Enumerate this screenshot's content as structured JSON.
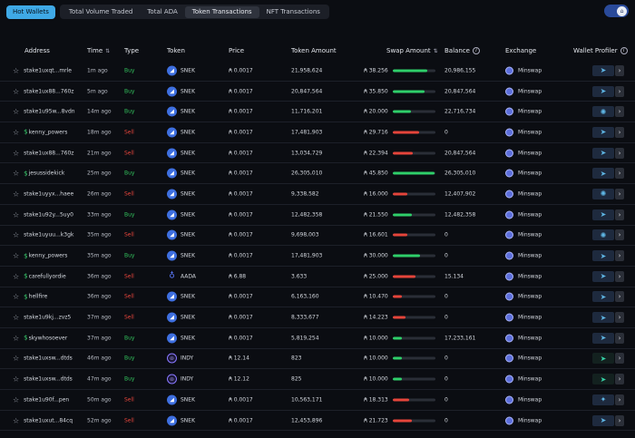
{
  "tabs": {
    "hot": "Hot Wallets",
    "items": [
      "Total Volume Traded",
      "Total ADA",
      "Token Transactions",
      "NFT Transactions"
    ],
    "active_index": 2
  },
  "toggle": {
    "icon": "home-icon",
    "accent": "#2a4a9a"
  },
  "headers": {
    "address": "Address",
    "time": "Time",
    "type": "Type",
    "token": "Token",
    "price": "Price",
    "token_amount": "Token Amount",
    "swap_amount": "Swap Amount",
    "balance": "Balance",
    "exchange": "Exchange",
    "wallet_profiler": "Wallet Profiler"
  },
  "colors": {
    "buy": "#32c25d",
    "sell": "#e5453b",
    "accent": "#3fa9e6"
  },
  "rows": [
    {
      "address": "stake1uxqt...mrle",
      "dollar": false,
      "time": "1m ago",
      "type": "Buy",
      "token": "SNEK",
      "price": "₳ 0.0017",
      "amount": "21,958,624",
      "swap": "₳ 38.256",
      "fill": 0.82,
      "balance": "20,986,155",
      "exchange": "Minswap",
      "whale": "shark"
    },
    {
      "address": "stake1ux88...760z",
      "dollar": false,
      "time": "5m ago",
      "type": "Buy",
      "token": "SNEK",
      "price": "₳ 0.0017",
      "amount": "20,847,564",
      "swap": "₳ 35.850",
      "fill": 0.76,
      "balance": "20,847,564",
      "exchange": "Minswap",
      "whale": "shark"
    },
    {
      "address": "stake1u95w...8vdn",
      "dollar": false,
      "time": "14m ago",
      "type": "Buy",
      "token": "SNEK",
      "price": "₳ 0.0017",
      "amount": "11,716,201",
      "swap": "₳ 20.000",
      "fill": 0.43,
      "balance": "22,716,734",
      "exchange": "Minswap",
      "whale": "octopus"
    },
    {
      "address": "kenny_powers",
      "dollar": true,
      "time": "18m ago",
      "type": "Sell",
      "token": "SNEK",
      "price": "₳ 0.0017",
      "amount": "17,481,903",
      "swap": "₳ 29.716",
      "fill": 0.63,
      "balance": "0",
      "exchange": "Minswap",
      "whale": "shark"
    },
    {
      "address": "stake1ux88...760z",
      "dollar": false,
      "time": "21m ago",
      "type": "Sell",
      "token": "SNEK",
      "price": "₳ 0.0017",
      "amount": "13,034,729",
      "swap": "₳ 22.394",
      "fill": 0.48,
      "balance": "20,847,564",
      "exchange": "Minswap",
      "whale": "shark"
    },
    {
      "address": "jesussidekick",
      "dollar": true,
      "time": "25m ago",
      "type": "Buy",
      "token": "SNEK",
      "price": "₳ 0.0017",
      "amount": "26,305,010",
      "swap": "₳ 45.850",
      "fill": 0.98,
      "balance": "26,305,010",
      "exchange": "Minswap",
      "whale": "shark"
    },
    {
      "address": "stake1uyyx...haee",
      "dollar": false,
      "time": "26m ago",
      "type": "Sell",
      "token": "SNEK",
      "price": "₳ 0.0017",
      "amount": "9,338,582",
      "swap": "₳ 16.000",
      "fill": 0.34,
      "balance": "12,407,902",
      "exchange": "Minswap",
      "whale": "octopus"
    },
    {
      "address": "stake1u92y...5uy0",
      "dollar": false,
      "time": "33m ago",
      "type": "Buy",
      "token": "SNEK",
      "price": "₳ 0.0017",
      "amount": "12,482,358",
      "swap": "₳ 21.550",
      "fill": 0.46,
      "balance": "12,482,358",
      "exchange": "Minswap",
      "whale": "shark"
    },
    {
      "address": "stake1uyuu...k3gk",
      "dollar": false,
      "time": "35m ago",
      "type": "Sell",
      "token": "SNEK",
      "price": "₳ 0.0017",
      "amount": "9,698,003",
      "swap": "₳ 16.601",
      "fill": 0.35,
      "balance": "0",
      "exchange": "Minswap",
      "whale": "octopus"
    },
    {
      "address": "kenny_powers",
      "dollar": true,
      "time": "35m ago",
      "type": "Buy",
      "token": "SNEK",
      "price": "₳ 0.0017",
      "amount": "17,481,903",
      "swap": "₳ 30.000",
      "fill": 0.64,
      "balance": "0",
      "exchange": "Minswap",
      "whale": "shark"
    },
    {
      "address": "carefullyordie",
      "dollar": true,
      "time": "36m ago",
      "type": "Sell",
      "token": "AADA",
      "price": "₳ 6.88",
      "amount": "3.633",
      "swap": "₳ 25.000",
      "fill": 0.53,
      "balance": "15.134",
      "exchange": "Minswap",
      "whale": "shark"
    },
    {
      "address": "hellfire",
      "dollar": true,
      "time": "36m ago",
      "type": "Sell",
      "token": "SNEK",
      "price": "₳ 0.0017",
      "amount": "6,163,160",
      "swap": "₳ 10.470",
      "fill": 0.22,
      "balance": "0",
      "exchange": "Minswap",
      "whale": "shark"
    },
    {
      "address": "stake1u9kj...zvz5",
      "dollar": false,
      "time": "37m ago",
      "type": "Sell",
      "token": "SNEK",
      "price": "₳ 0.0017",
      "amount": "8,333,677",
      "swap": "₳ 14.223",
      "fill": 0.3,
      "balance": "0",
      "exchange": "Minswap",
      "whale": "shark"
    },
    {
      "address": "skywhosoever",
      "dollar": true,
      "time": "37m ago",
      "type": "Buy",
      "token": "SNEK",
      "price": "₳ 0.0017",
      "amount": "5,819,254",
      "swap": "₳ 10.000",
      "fill": 0.21,
      "balance": "17,233,161",
      "exchange": "Minswap",
      "whale": "shark"
    },
    {
      "address": "stake1uxsw...dtds",
      "dollar": false,
      "time": "46m ago",
      "type": "Buy",
      "token": "INDY",
      "price": "₳ 12.14",
      "amount": "823",
      "swap": "₳ 10.000",
      "fill": 0.21,
      "balance": "0",
      "exchange": "Minswap",
      "whale": "shark-dark"
    },
    {
      "address": "stake1uxsw...dtds",
      "dollar": false,
      "time": "47m ago",
      "type": "Buy",
      "token": "INDY",
      "price": "₳ 12.12",
      "amount": "825",
      "swap": "₳ 10.000",
      "fill": 0.21,
      "balance": "0",
      "exchange": "Minswap",
      "whale": "shark-dark"
    },
    {
      "address": "stake1u90f...pen",
      "dollar": false,
      "time": "50m ago",
      "type": "Sell",
      "token": "SNEK",
      "price": "₳ 0.0017",
      "amount": "10,563,171",
      "swap": "₳ 18.313",
      "fill": 0.39,
      "balance": "0",
      "exchange": "Minswap",
      "whale": "crab"
    },
    {
      "address": "stake1uxut...84cq",
      "dollar": false,
      "time": "52m ago",
      "type": "Sell",
      "token": "SNEK",
      "price": "₳ 0.0017",
      "amount": "12,453,896",
      "swap": "₳ 21.723",
      "fill": 0.46,
      "balance": "0",
      "exchange": "Minswap",
      "whale": "shark"
    }
  ]
}
